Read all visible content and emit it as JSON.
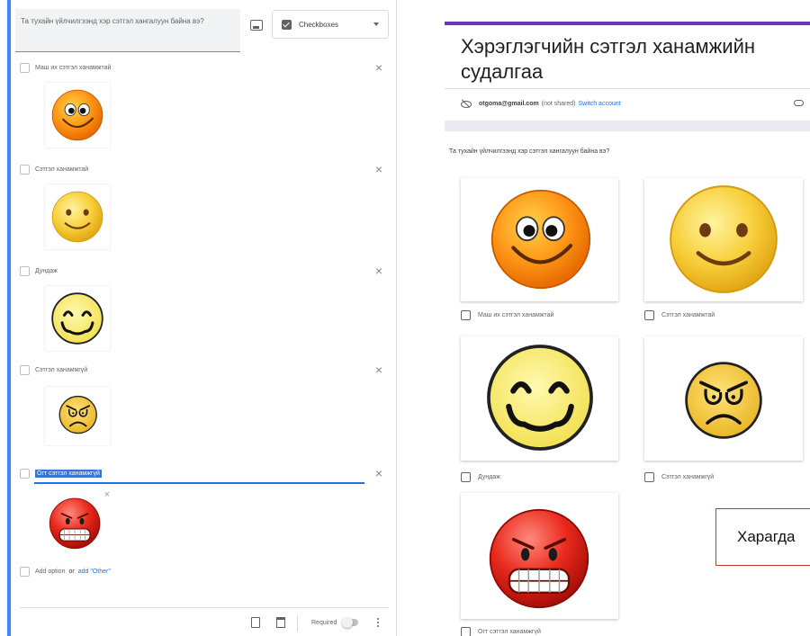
{
  "editor": {
    "question_title": "Та тухайн үйлчилгээнд хэр сэтгэл хангалуун байна вэ?",
    "question_type": "Checkboxes",
    "options": [
      {
        "label": "Маш их сэтгэл ханамжтай",
        "face": "very-happy-face-icon"
      },
      {
        "label": "Сэтгэл ханамжтай",
        "face": "happy-face-icon"
      },
      {
        "label": "Дундаж",
        "face": "neutral-face-icon"
      },
      {
        "label": "Сэтгэл ханамжгүй",
        "face": "unhappy-face-icon"
      },
      {
        "label": "Огт сэтгэл ханамжгүй",
        "face": "angry-face-icon"
      }
    ],
    "add_option": "Add option",
    "or_text": "or",
    "add_other": "add \"Other\"",
    "required_label": "Required",
    "required_on": false
  },
  "preview": {
    "form_title": "Хэрэглэгчийн сэтгэл ханамжийн судалгаа",
    "account_email": "otgoma@gmail.com",
    "account_not_shared": "(not shared)",
    "switch_account": "Switch account",
    "question": "Та тухайн үйлчилгээнд хэр сэтгэл хангалуун байна вэ?",
    "choices": [
      "Маш их сэтгэл ханамжтай",
      "Сэтгэл ханамжтай",
      "Дундаж",
      "Сэтгэл ханамжгүй",
      "Огт сэтгэл ханамжгүй"
    ],
    "callout_text": "Харагда"
  },
  "colors": {
    "editor_accent": "#4285f4",
    "form_accent": "#673ab7",
    "link": "#1a73e8",
    "callout_border": "#c0392b"
  }
}
